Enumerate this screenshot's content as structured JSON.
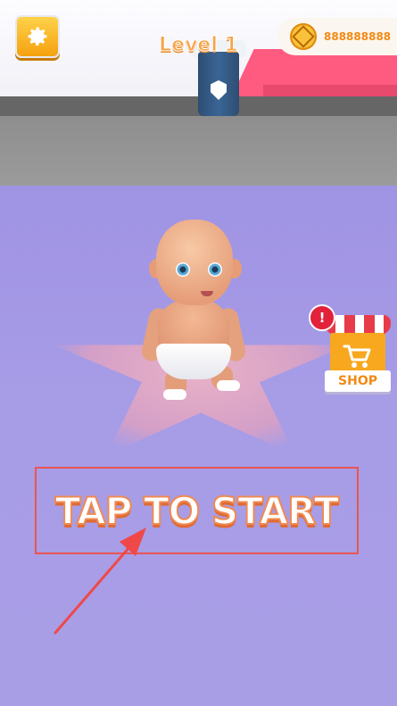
{
  "hud": {
    "level_label": "Level 1",
    "coins": "888888888",
    "settings_icon": "gear-icon",
    "coin_icon": "coin-icon"
  },
  "shop": {
    "label": "SHOP",
    "alert_badge": "!",
    "icon": "shopping-cart-icon"
  },
  "prompt": {
    "tap_to_start": "TAP TO START"
  },
  "colors": {
    "accent_orange": "#f28a15",
    "highlight_box": "#e95454",
    "floor": "#a79ce6",
    "alert_red": "#e2223a"
  }
}
